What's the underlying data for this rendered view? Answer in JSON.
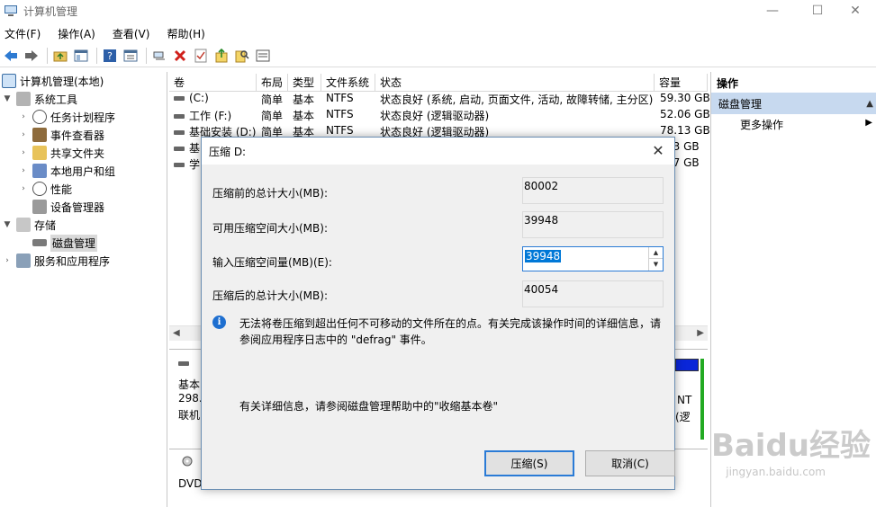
{
  "window": {
    "title": "计算机管理",
    "minimize": "—",
    "maximize": "☐",
    "close": "✕"
  },
  "menubar": [
    {
      "label": "文件(F)"
    },
    {
      "label": "操作(A)"
    },
    {
      "label": "查看(V)"
    },
    {
      "label": "帮助(H)"
    }
  ],
  "toolbar": {
    "icons": [
      "back-arrow-icon",
      "forward-arrow-icon",
      "folder-up-icon",
      "show-hide-tree-icon",
      "help-icon",
      "properties-icon",
      "connect-icon",
      "delete-icon",
      "check-icon",
      "export-icon",
      "search-icon",
      "list-icon"
    ]
  },
  "tree": {
    "root": "计算机管理(本地)",
    "system_tools": "系统工具",
    "task_scheduler": "任务计划程序",
    "event_viewer": "事件查看器",
    "shared_folders": "共享文件夹",
    "local_users": "本地用户和组",
    "performance": "性能",
    "device_manager": "设备管理器",
    "storage": "存储",
    "disk_management": "磁盘管理",
    "services_apps": "服务和应用程序"
  },
  "volume_table": {
    "columns": [
      "卷",
      "布局",
      "类型",
      "文件系统",
      "状态",
      "容量"
    ],
    "rows": [
      {
        "vol": "(C:)",
        "layout": "简单",
        "type": "基本",
        "fs": "NTFS",
        "status": "状态良好 (系统, 启动, 页面文件, 活动, 故障转储, 主分区)",
        "capacity": "59.30 GB"
      },
      {
        "vol": "工作 (F:)",
        "layout": "简单",
        "type": "基本",
        "fs": "NTFS",
        "status": "状态良好 (逻辑驱动器)",
        "capacity": "52.06 GB"
      },
      {
        "vol": "基础安装 (D:)",
        "layout": "简单",
        "type": "基本",
        "fs": "NTFS",
        "status": "状态良好 (逻辑驱动器)",
        "capacity": "78.13 GB"
      },
      {
        "vol": "基",
        "layout": "",
        "type": "",
        "fs": "",
        "status": "",
        "capacity": "13 GB"
      },
      {
        "vol": "学",
        "layout": "",
        "type": "",
        "fs": "",
        "status": "",
        "capacity": "47 GB"
      }
    ]
  },
  "graph": {
    "disk0_line1": "基本",
    "disk0_line2": "298.",
    "disk0_line3": "联机",
    "cd_label": "DVD",
    "right_fs": "NT",
    "right_status": "(逻"
  },
  "actions": {
    "header": "操作",
    "selected": "磁盘管理",
    "more": "更多操作"
  },
  "dialog": {
    "title": "压缩 D:",
    "total_before_label": "压缩前的总计大小(MB):",
    "total_before_value": "80002",
    "available_label": "可用压缩空间大小(MB):",
    "available_value": "39948",
    "enter_label": "输入压缩空间量(MB)(E):",
    "enter_value": "39948",
    "total_after_label": "压缩后的总计大小(MB):",
    "total_after_value": "40054",
    "info_text": "无法将卷压缩到超出任何不可移动的文件所在的点。有关完成该操作时间的详细信息，请参阅应用程序日志中的 \"defrag\" 事件。",
    "more_info": "有关详细信息，请参阅磁盘管理帮助中的\"收缩基本卷\"",
    "shrink_button": "压缩(S)",
    "cancel_button": "取消(C)"
  },
  "watermark": {
    "brand": "Baidu经验",
    "url": "jingyan.baidu.com"
  }
}
